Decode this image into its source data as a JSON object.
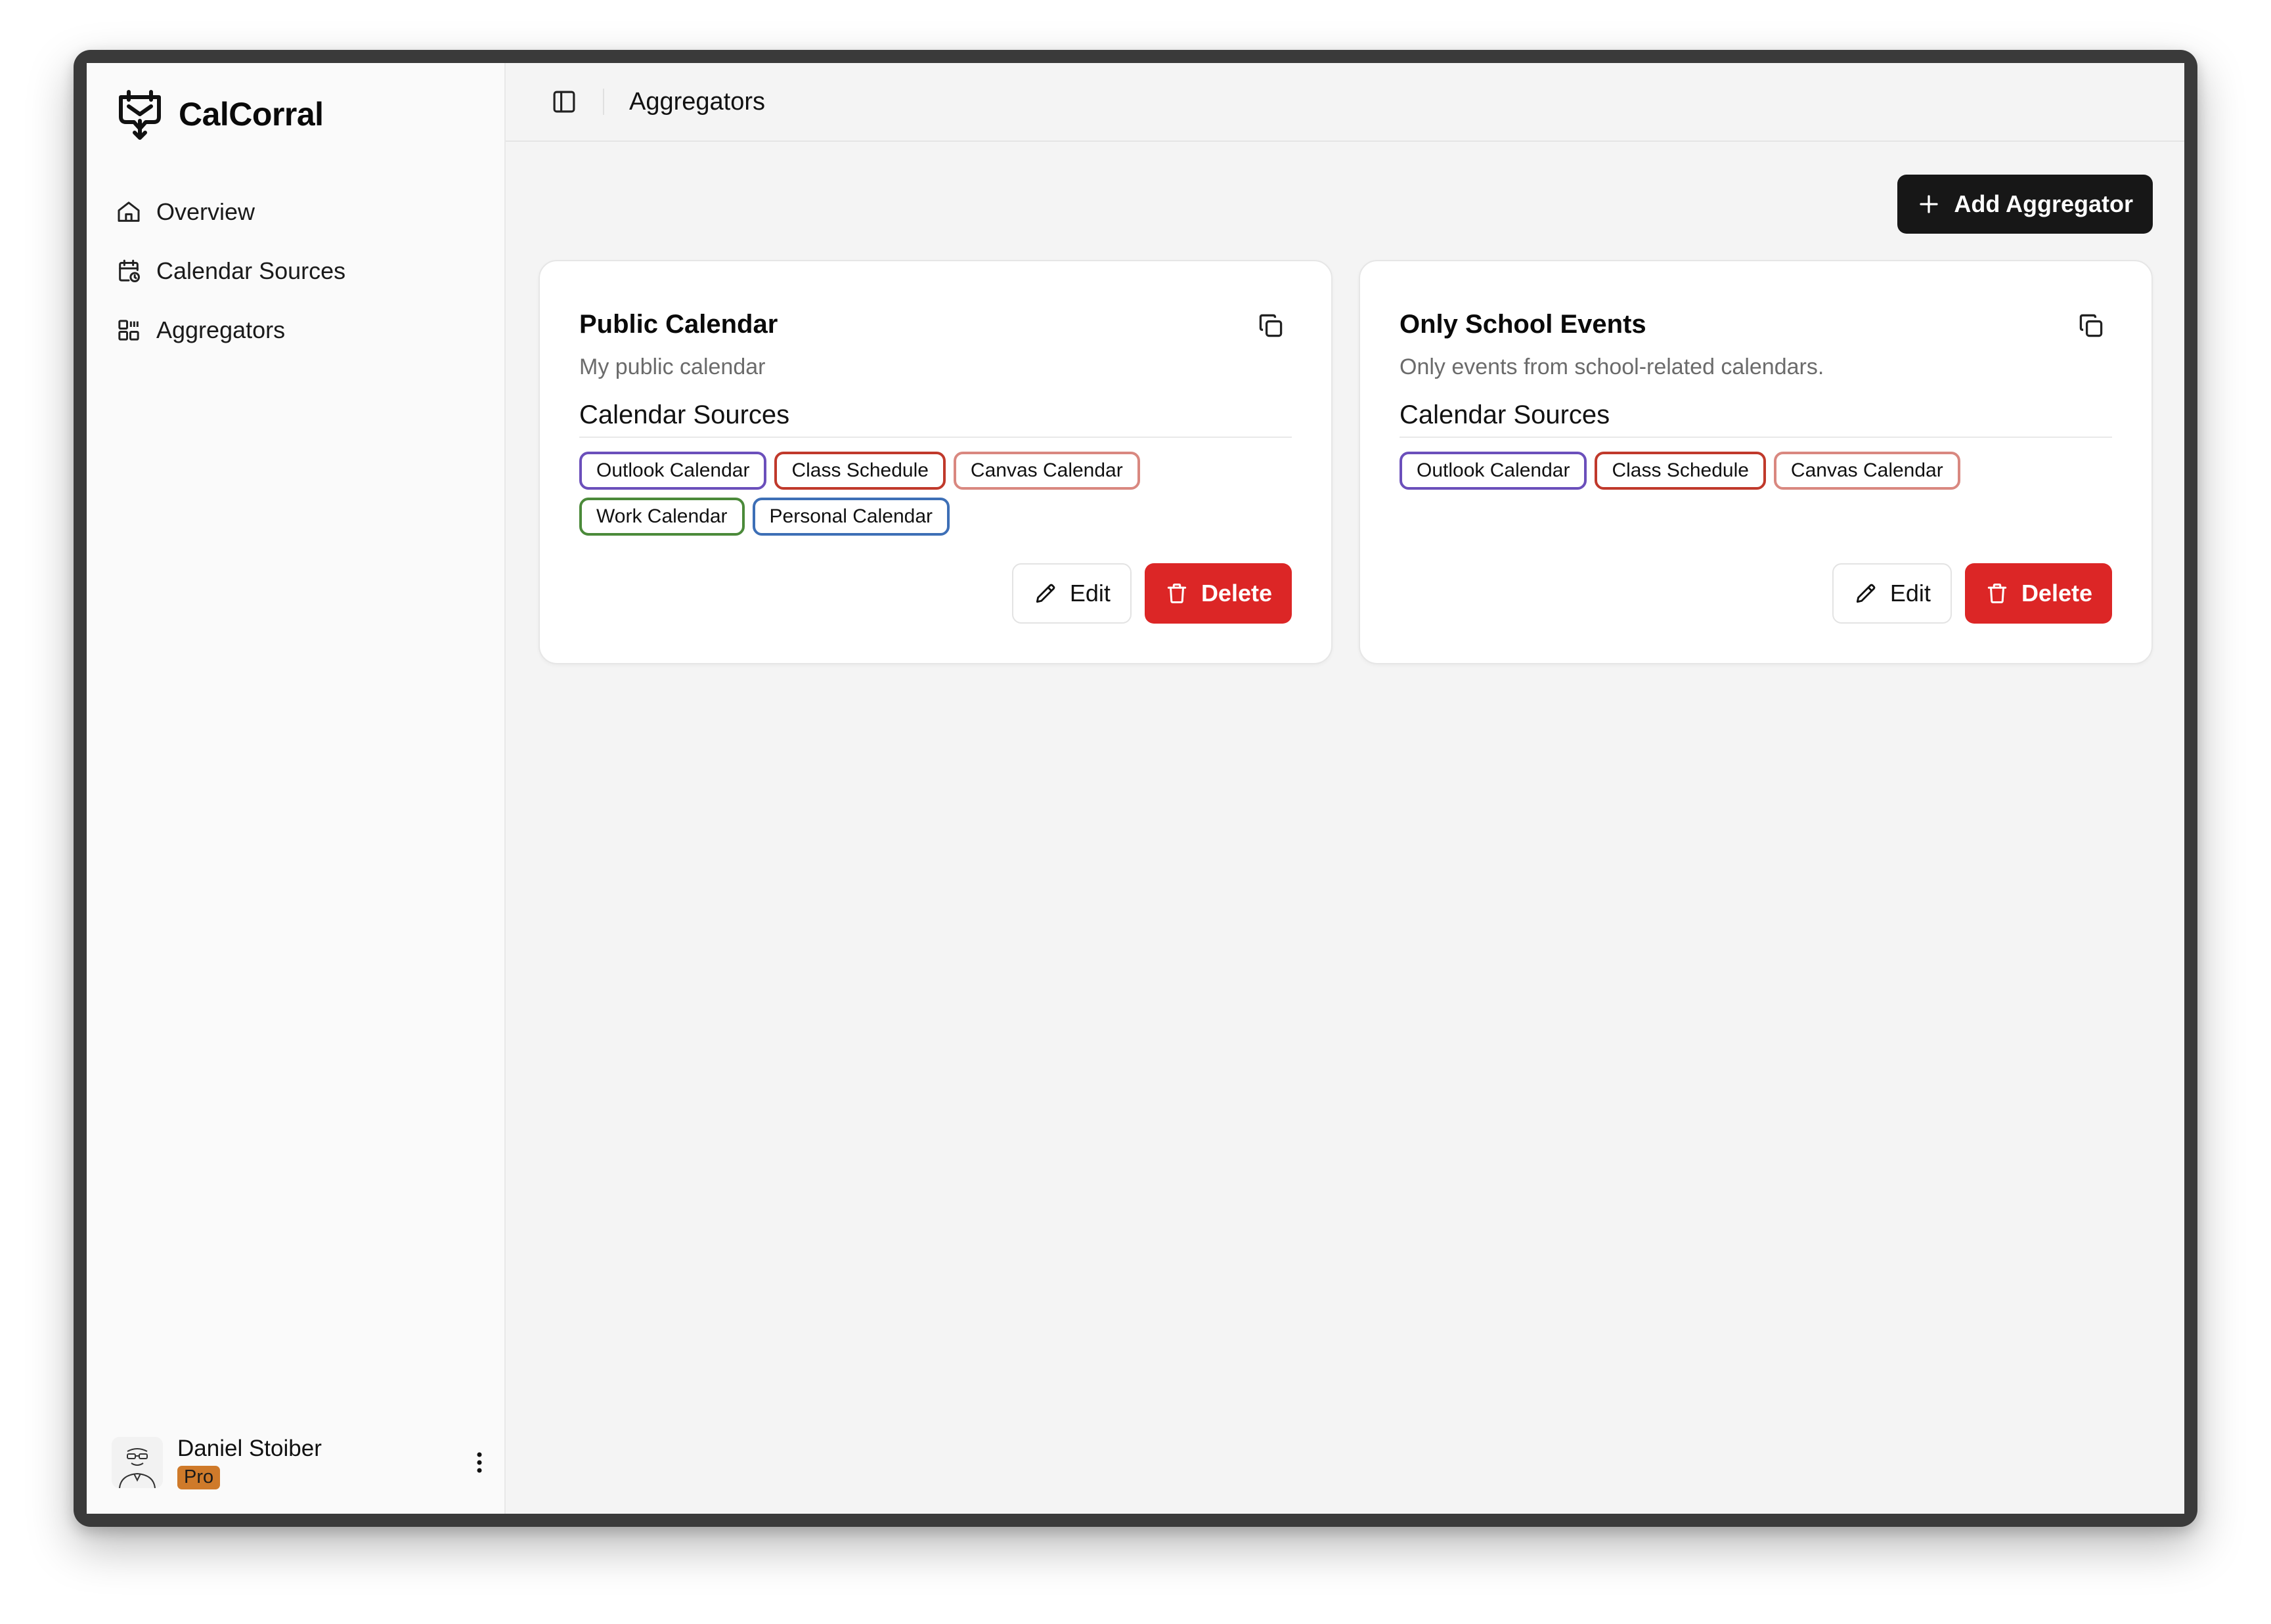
{
  "app": {
    "name": "CalCorral"
  },
  "sidebar": {
    "items": [
      {
        "label": "Overview",
        "icon": "home-icon"
      },
      {
        "label": "Calendar Sources",
        "icon": "calendar-clock-icon"
      },
      {
        "label": "Aggregators",
        "icon": "grid-icon"
      }
    ]
  },
  "user": {
    "name": "Daniel Stoiber",
    "plan": "Pro"
  },
  "header": {
    "title": "Aggregators"
  },
  "toolbar": {
    "add_label": "Add Aggregator"
  },
  "colors": {
    "purple": "#6b4fbb",
    "red": "#c0392b",
    "salmon": "#d98880",
    "green": "#4b8a3a",
    "blue": "#3d6fb6",
    "danger": "#dc2626"
  },
  "cards": [
    {
      "title": "Public Calendar",
      "description": "My public calendar",
      "sources_label": "Calendar Sources",
      "sources": [
        {
          "label": "Outlook Calendar",
          "color": "#6b4fbb"
        },
        {
          "label": "Class Schedule",
          "color": "#c0392b"
        },
        {
          "label": "Canvas Calendar",
          "color": "#d98880"
        },
        {
          "label": "Work Calendar",
          "color": "#4b8a3a"
        },
        {
          "label": "Personal Calendar",
          "color": "#3d6fb6"
        }
      ],
      "edit_label": "Edit",
      "delete_label": "Delete"
    },
    {
      "title": "Only School Events",
      "description": "Only events from school-related calendars.",
      "sources_label": "Calendar Sources",
      "sources": [
        {
          "label": "Outlook Calendar",
          "color": "#6b4fbb"
        },
        {
          "label": "Class Schedule",
          "color": "#c0392b"
        },
        {
          "label": "Canvas Calendar",
          "color": "#d98880"
        }
      ],
      "edit_label": "Edit",
      "delete_label": "Delete"
    }
  ]
}
